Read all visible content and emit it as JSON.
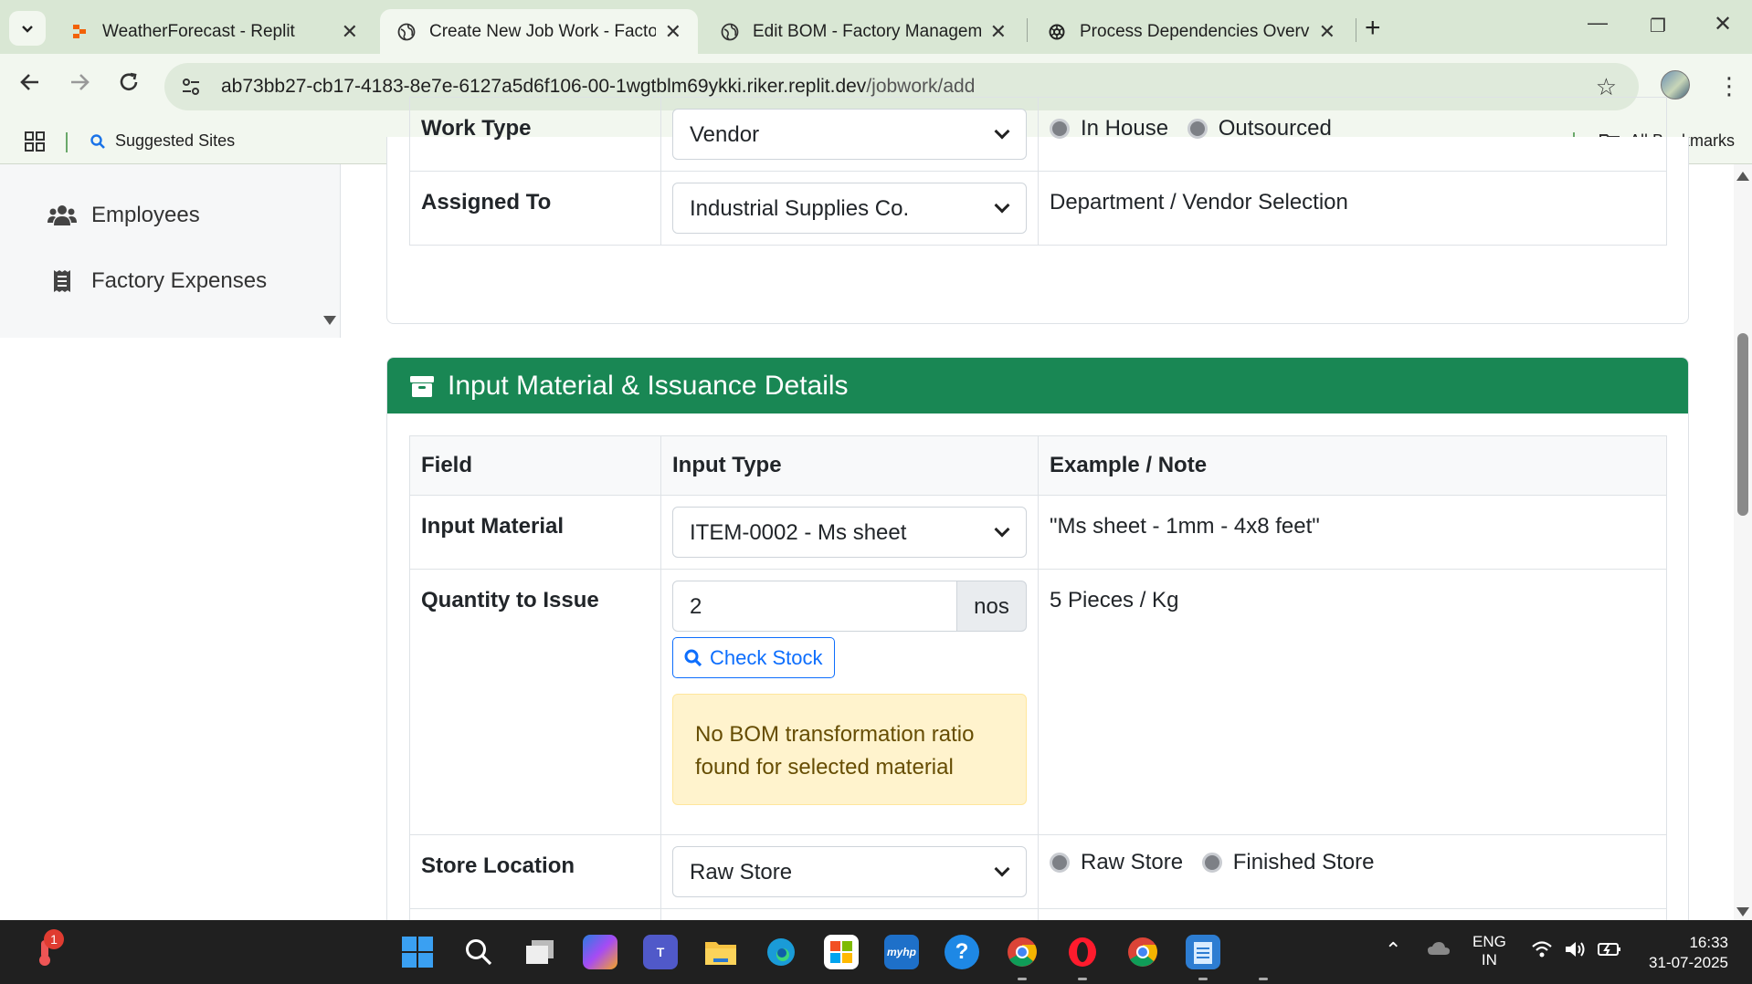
{
  "browser": {
    "tabs": [
      {
        "title": "WeatherForecast - Replit",
        "active": false,
        "icon": "replit-icon"
      },
      {
        "title": "Create New Job Work - Factory",
        "active": true,
        "icon": "globe-icon"
      },
      {
        "title": "Edit BOM - Factory Managemer",
        "active": false,
        "icon": "globe-icon"
      },
      {
        "title": "Process Dependencies Overview",
        "active": false,
        "icon": "openai-icon"
      }
    ],
    "url_host": "ab73bb27-cb17-4183-8e7e-6127a5d6f106-00-1wgtblm69ykki.riker.replit.dev",
    "url_path": "/jobwork/add",
    "bookmarks": {
      "suggested": "Suggested Sites",
      "all": "All Bookmarks"
    }
  },
  "sidebar": {
    "items": [
      {
        "label": "Employees",
        "icon": "users-icon"
      },
      {
        "label": "Factory Expenses",
        "icon": "receipt-icon"
      }
    ]
  },
  "top_section": {
    "partial_label": "Work Type",
    "partial_value": "Vendor",
    "partial_note_opt1": "In House",
    "partial_note_opt2": "Outsourced",
    "assigned_label": "Assigned To",
    "assigned_value": "Industrial Supplies Co.",
    "assigned_note": "Department / Vendor Selection"
  },
  "input_section": {
    "title": "Input Material & Issuance Details",
    "headers": {
      "field": "Field",
      "input_type": "Input Type",
      "note": "Example / Note"
    },
    "input_material": {
      "label": "Input Material",
      "value": "ITEM-0002 - Ms sheet",
      "note": "\"Ms sheet - 1mm - 4x8 feet\""
    },
    "quantity": {
      "label": "Quantity to Issue",
      "value": "2",
      "unit": "nos",
      "check_stock": "Check Stock",
      "alert": "No BOM transformation ratio found for selected material",
      "note": "5 Pieces / Kg"
    },
    "store": {
      "label": "Store Location",
      "value": "Raw Store",
      "radio1": "Raw Store",
      "radio2": "Finished Store"
    }
  },
  "taskbar": {
    "notification_count": "1",
    "lang": "ENG",
    "region": "IN",
    "time": "16:33",
    "date": "31-07-2025"
  },
  "colors": {
    "header_green": "#198754",
    "primary_blue": "#0d6efd",
    "alert_bg": "#fff3cd",
    "chrome_bg": "#d9e7d4"
  }
}
